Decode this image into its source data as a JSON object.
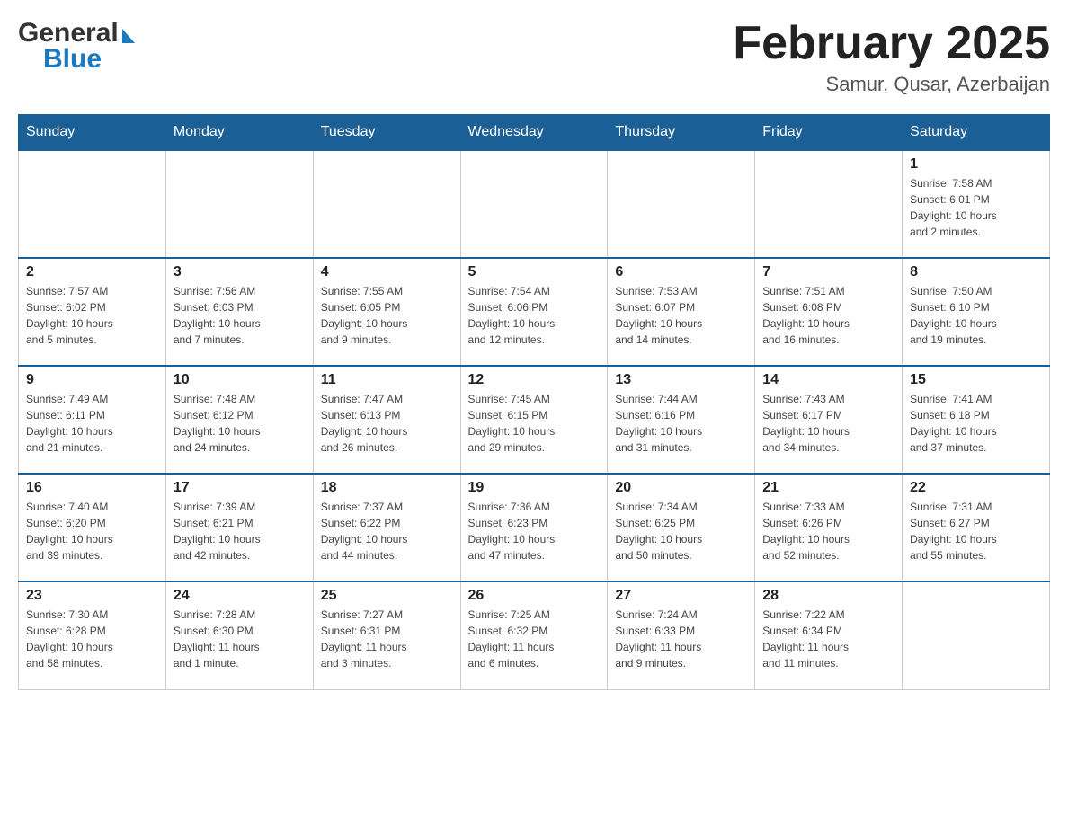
{
  "header": {
    "logo_general": "General",
    "logo_blue": "Blue",
    "month_title": "February 2025",
    "location": "Samur, Qusar, Azerbaijan"
  },
  "weekdays": [
    "Sunday",
    "Monday",
    "Tuesday",
    "Wednesday",
    "Thursday",
    "Friday",
    "Saturday"
  ],
  "weeks": [
    [
      {
        "day": "",
        "info": ""
      },
      {
        "day": "",
        "info": ""
      },
      {
        "day": "",
        "info": ""
      },
      {
        "day": "",
        "info": ""
      },
      {
        "day": "",
        "info": ""
      },
      {
        "day": "",
        "info": ""
      },
      {
        "day": "1",
        "info": "Sunrise: 7:58 AM\nSunset: 6:01 PM\nDaylight: 10 hours\nand 2 minutes."
      }
    ],
    [
      {
        "day": "2",
        "info": "Sunrise: 7:57 AM\nSunset: 6:02 PM\nDaylight: 10 hours\nand 5 minutes."
      },
      {
        "day": "3",
        "info": "Sunrise: 7:56 AM\nSunset: 6:03 PM\nDaylight: 10 hours\nand 7 minutes."
      },
      {
        "day": "4",
        "info": "Sunrise: 7:55 AM\nSunset: 6:05 PM\nDaylight: 10 hours\nand 9 minutes."
      },
      {
        "day": "5",
        "info": "Sunrise: 7:54 AM\nSunset: 6:06 PM\nDaylight: 10 hours\nand 12 minutes."
      },
      {
        "day": "6",
        "info": "Sunrise: 7:53 AM\nSunset: 6:07 PM\nDaylight: 10 hours\nand 14 minutes."
      },
      {
        "day": "7",
        "info": "Sunrise: 7:51 AM\nSunset: 6:08 PM\nDaylight: 10 hours\nand 16 minutes."
      },
      {
        "day": "8",
        "info": "Sunrise: 7:50 AM\nSunset: 6:10 PM\nDaylight: 10 hours\nand 19 minutes."
      }
    ],
    [
      {
        "day": "9",
        "info": "Sunrise: 7:49 AM\nSunset: 6:11 PM\nDaylight: 10 hours\nand 21 minutes."
      },
      {
        "day": "10",
        "info": "Sunrise: 7:48 AM\nSunset: 6:12 PM\nDaylight: 10 hours\nand 24 minutes."
      },
      {
        "day": "11",
        "info": "Sunrise: 7:47 AM\nSunset: 6:13 PM\nDaylight: 10 hours\nand 26 minutes."
      },
      {
        "day": "12",
        "info": "Sunrise: 7:45 AM\nSunset: 6:15 PM\nDaylight: 10 hours\nand 29 minutes."
      },
      {
        "day": "13",
        "info": "Sunrise: 7:44 AM\nSunset: 6:16 PM\nDaylight: 10 hours\nand 31 minutes."
      },
      {
        "day": "14",
        "info": "Sunrise: 7:43 AM\nSunset: 6:17 PM\nDaylight: 10 hours\nand 34 minutes."
      },
      {
        "day": "15",
        "info": "Sunrise: 7:41 AM\nSunset: 6:18 PM\nDaylight: 10 hours\nand 37 minutes."
      }
    ],
    [
      {
        "day": "16",
        "info": "Sunrise: 7:40 AM\nSunset: 6:20 PM\nDaylight: 10 hours\nand 39 minutes."
      },
      {
        "day": "17",
        "info": "Sunrise: 7:39 AM\nSunset: 6:21 PM\nDaylight: 10 hours\nand 42 minutes."
      },
      {
        "day": "18",
        "info": "Sunrise: 7:37 AM\nSunset: 6:22 PM\nDaylight: 10 hours\nand 44 minutes."
      },
      {
        "day": "19",
        "info": "Sunrise: 7:36 AM\nSunset: 6:23 PM\nDaylight: 10 hours\nand 47 minutes."
      },
      {
        "day": "20",
        "info": "Sunrise: 7:34 AM\nSunset: 6:25 PM\nDaylight: 10 hours\nand 50 minutes."
      },
      {
        "day": "21",
        "info": "Sunrise: 7:33 AM\nSunset: 6:26 PM\nDaylight: 10 hours\nand 52 minutes."
      },
      {
        "day": "22",
        "info": "Sunrise: 7:31 AM\nSunset: 6:27 PM\nDaylight: 10 hours\nand 55 minutes."
      }
    ],
    [
      {
        "day": "23",
        "info": "Sunrise: 7:30 AM\nSunset: 6:28 PM\nDaylight: 10 hours\nand 58 minutes."
      },
      {
        "day": "24",
        "info": "Sunrise: 7:28 AM\nSunset: 6:30 PM\nDaylight: 11 hours\nand 1 minute."
      },
      {
        "day": "25",
        "info": "Sunrise: 7:27 AM\nSunset: 6:31 PM\nDaylight: 11 hours\nand 3 minutes."
      },
      {
        "day": "26",
        "info": "Sunrise: 7:25 AM\nSunset: 6:32 PM\nDaylight: 11 hours\nand 6 minutes."
      },
      {
        "day": "27",
        "info": "Sunrise: 7:24 AM\nSunset: 6:33 PM\nDaylight: 11 hours\nand 9 minutes."
      },
      {
        "day": "28",
        "info": "Sunrise: 7:22 AM\nSunset: 6:34 PM\nDaylight: 11 hours\nand 11 minutes."
      },
      {
        "day": "",
        "info": ""
      }
    ]
  ]
}
